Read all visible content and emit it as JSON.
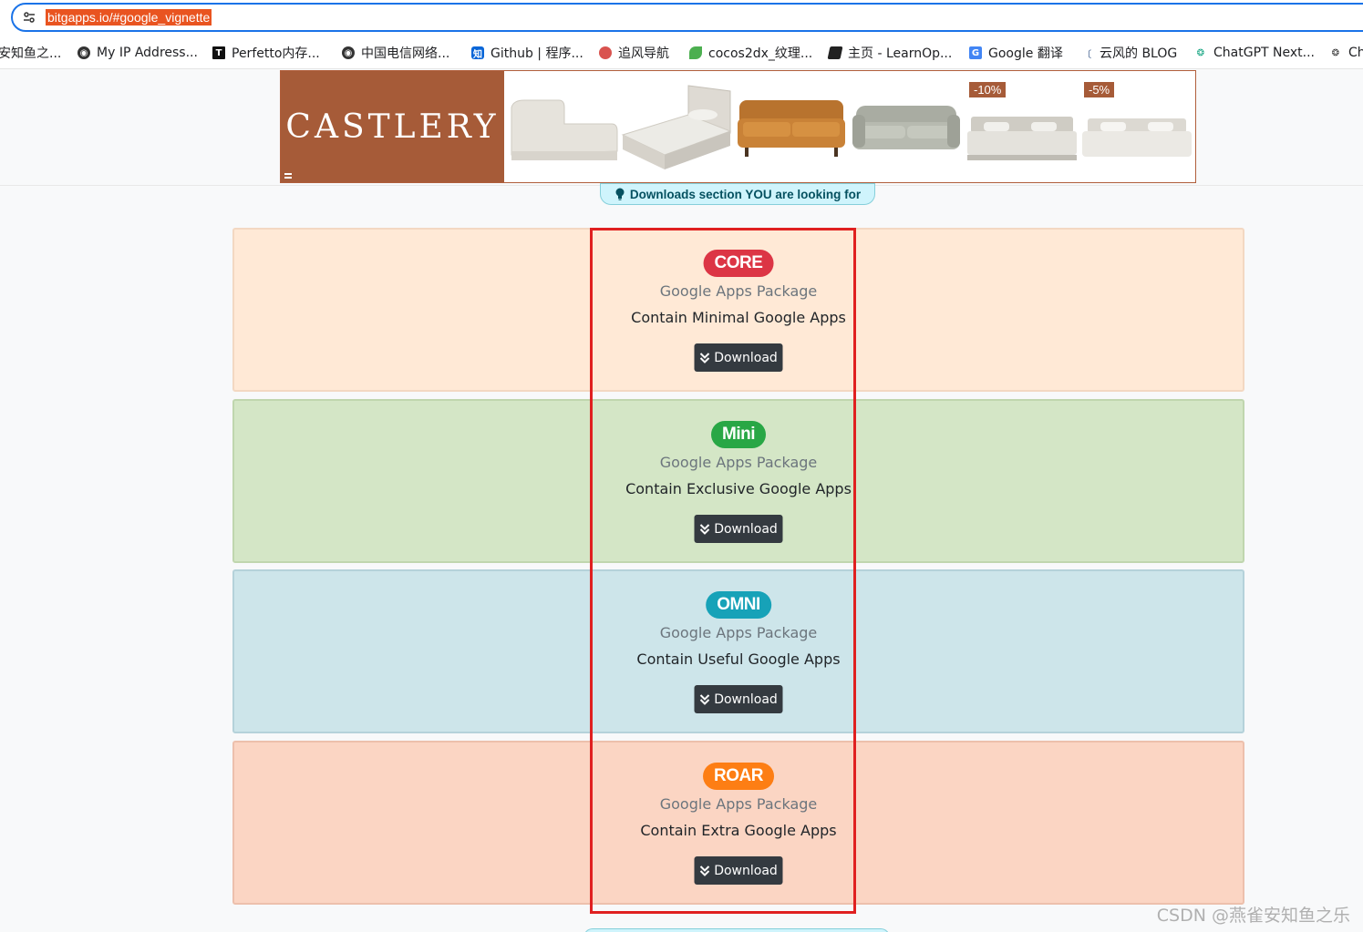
{
  "browser": {
    "url": "bitgapps.io/#google_vignette"
  },
  "bookmarks": [
    {
      "label": "安知鱼之...",
      "icon": "none"
    },
    {
      "label": "My IP Address...",
      "icon": "globe-icon"
    },
    {
      "label": "Perfetto内存...",
      "icon": "t-logo-icon"
    },
    {
      "label": "中国电信网络...",
      "icon": "globe-icon"
    },
    {
      "label": "Github | 程序...",
      "icon": "zhihu-icon"
    },
    {
      "label": "追风导航",
      "icon": "ball-icon"
    },
    {
      "label": "cocos2dx_纹理...",
      "icon": "leaf-icon"
    },
    {
      "label": "主页 - LearnOp...",
      "icon": "book-icon"
    },
    {
      "label": "Google 翻译",
      "icon": "translate-icon"
    },
    {
      "label": "云风的 BLOG",
      "icon": "feather-icon"
    },
    {
      "label": "ChatGPT Next...",
      "icon": "openai-icon"
    },
    {
      "label": "Ch",
      "icon": "openai-icon"
    }
  ],
  "ad": {
    "brand": "CASTLERY",
    "discounts": [
      "-10%",
      "-5%"
    ]
  },
  "pill": {
    "text": "Downloads section YOU are looking for"
  },
  "packages": [
    {
      "badge": "CORE",
      "subtitle": "Google Apps Package",
      "description": "Contain Minimal Google Apps",
      "button": "Download"
    },
    {
      "badge": "Mini",
      "subtitle": "Google Apps Package",
      "description": "Contain Exclusive Google Apps",
      "button": "Download"
    },
    {
      "badge": "OMNI",
      "subtitle": "Google Apps Package",
      "description": "Contain Useful Google Apps",
      "button": "Download"
    },
    {
      "badge": "ROAR",
      "subtitle": "Google Apps Package",
      "description": "Contain Extra Google Apps",
      "button": "Download"
    }
  ],
  "watermark": "CSDN @燕雀安知鱼之乐",
  "colors": {
    "core": "#dc3545",
    "mini": "#28a745",
    "omni": "#17a2b8",
    "roar": "#fd7e14",
    "highlight": "#e02020",
    "brand": "#a65b38"
  }
}
